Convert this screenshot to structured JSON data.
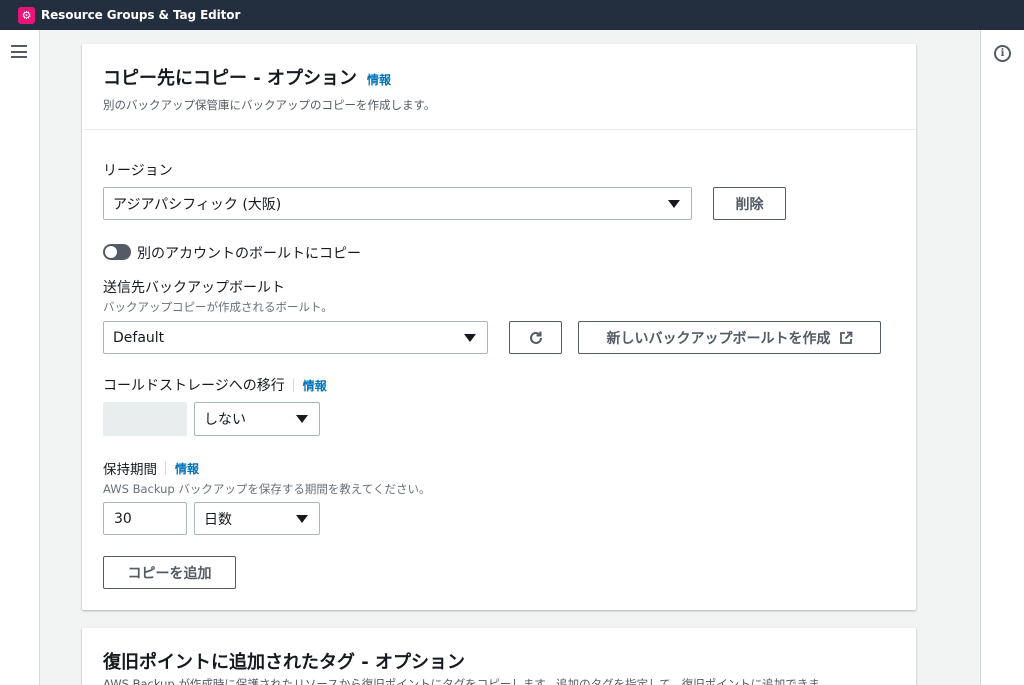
{
  "app": {
    "title": "Resource Groups & Tag Editor"
  },
  "copy_section": {
    "title": "コピー先にコピー - オプション",
    "info": "情報",
    "description": "別のバックアップ保管庫にバックアップのコピーを作成します。",
    "region_label": "リージョン",
    "region_value": "アジアパシフィック (大阪)",
    "remove_button": "削除",
    "toggle_label": "別のアカウントのボールトにコピー",
    "vault_label": "送信先バックアップボールト",
    "vault_desc": "バックアップコピーが作成されるボールト。",
    "vault_value": "Default",
    "create_vault_button": "新しいバックアップボールトを作成",
    "cold_storage_label": "コールドストレージへの移行",
    "cold_storage_info": "情報",
    "cold_storage_value": "しない",
    "retention_label": "保持期間",
    "retention_info": "情報",
    "retention_desc": "AWS Backup バックアップを保存する期間を教えてください。",
    "retention_value": "30",
    "retention_unit": "日数",
    "add_copy_button": "コピーを追加"
  },
  "tags_section": {
    "title": "復旧ポイントに追加されたタグ - オプション",
    "description": "AWS Backup が作成時に保護されたリソースから復旧ポイントにタグをコピーします。追加のタグを指定して、復旧ポイントに追加できま"
  },
  "colors": {
    "topbar": "#232f3e",
    "link": "#0073bb",
    "app_logo": "#e7157b"
  }
}
